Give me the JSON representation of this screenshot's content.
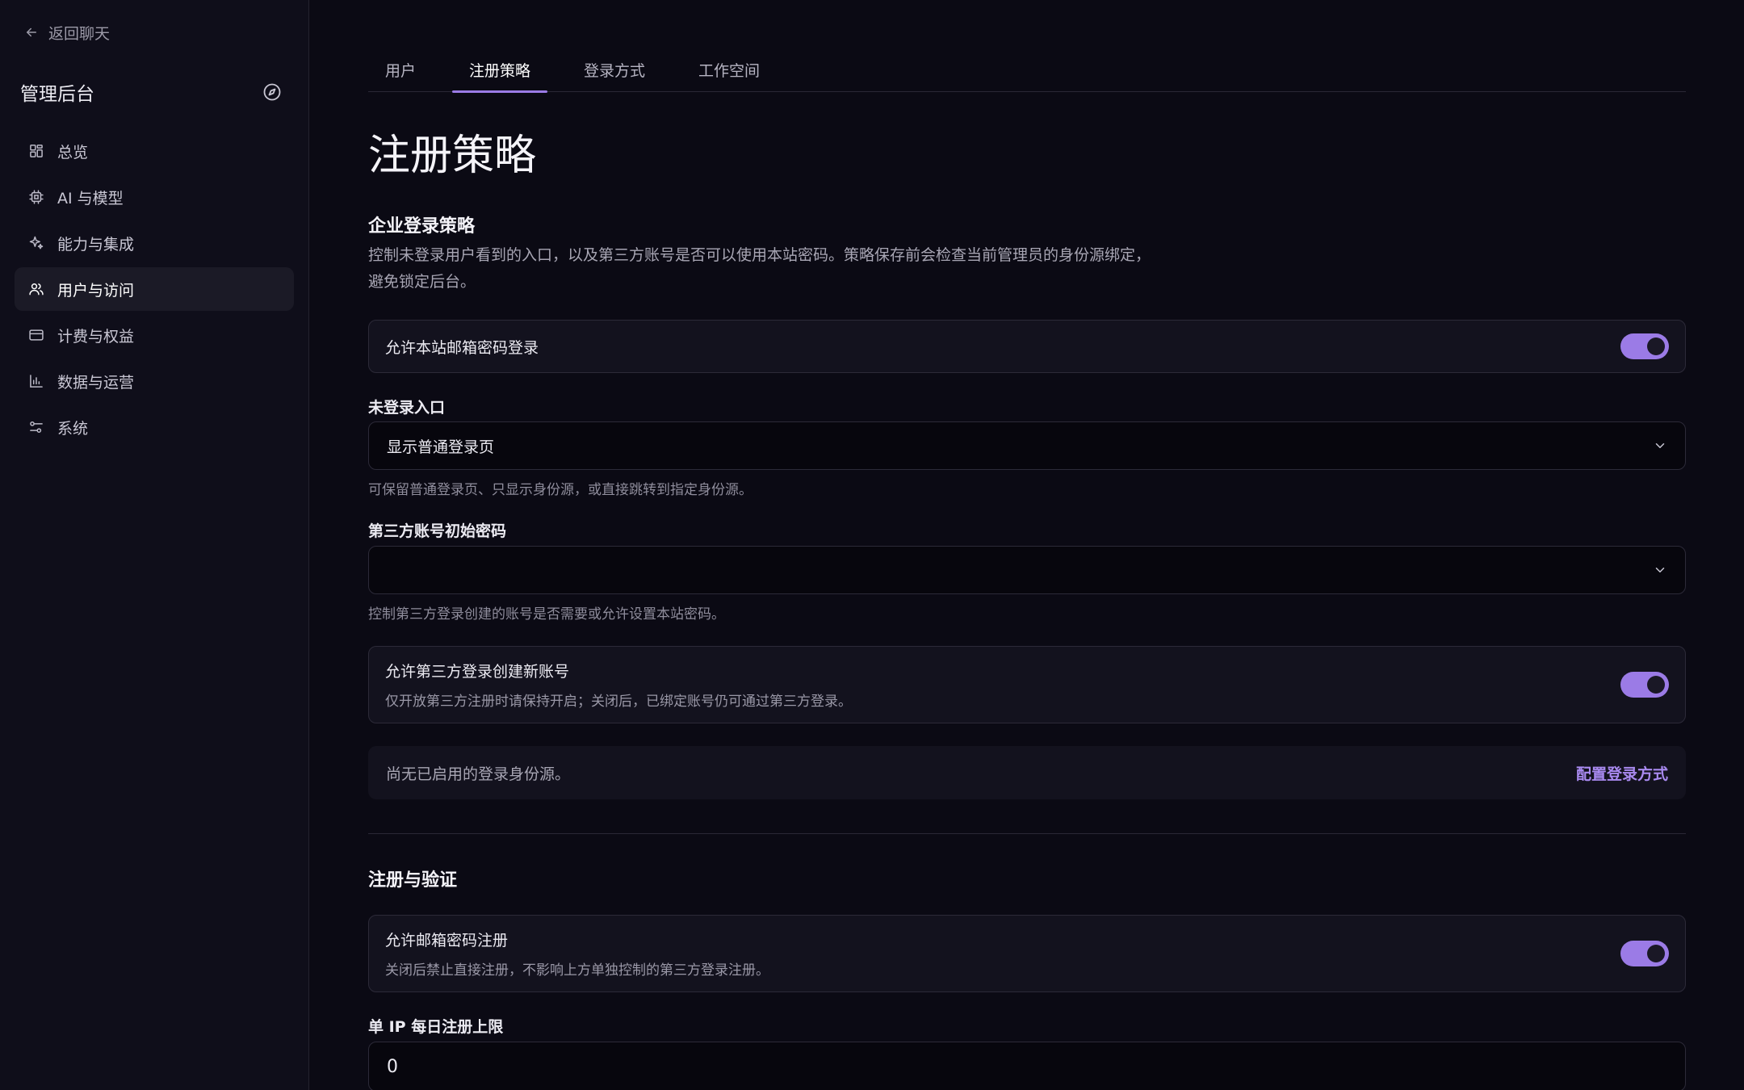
{
  "sidebar": {
    "back_label": "返回聊天",
    "title": "管理后台",
    "items": [
      {
        "label": "总览",
        "icon": "dashboard-icon"
      },
      {
        "label": "AI 与模型",
        "icon": "chip-icon"
      },
      {
        "label": "能力与集成",
        "icon": "sparkle-icon"
      },
      {
        "label": "用户与访问",
        "icon": "users-icon",
        "active": true
      },
      {
        "label": "计费与权益",
        "icon": "credit-card-icon"
      },
      {
        "label": "数据与运营",
        "icon": "bar-chart-icon"
      },
      {
        "label": "系统",
        "icon": "sliders-icon"
      }
    ]
  },
  "tabs": [
    {
      "label": "用户"
    },
    {
      "label": "注册策略",
      "active": true
    },
    {
      "label": "登录方式"
    },
    {
      "label": "工作空间"
    }
  ],
  "page": {
    "title": "注册策略",
    "enterprise": {
      "heading": "企业登录策略",
      "description_line1": "控制未登录用户看到的入口，以及第三方账号是否可以使用本站密码。策略保存前会检查当前管理员的身份源绑定，",
      "description_line2": "避免锁定后台。",
      "email_login_toggle": {
        "label": "允许本站邮箱密码登录",
        "enabled": true
      },
      "entry": {
        "label": "未登录入口",
        "value": "显示普通登录页",
        "help": "可保留普通登录页、只显示身份源，或直接跳转到指定身份源。"
      },
      "third_party_password": {
        "label": "第三方账号初始密码",
        "value": "",
        "help": "控制第三方登录创建的账号是否需要或允许设置本站密码。"
      },
      "third_party_create": {
        "label": "允许第三方登录创建新账号",
        "sub": "仅开放第三方注册时请保持开启；关闭后，已绑定账号仍可通过第三方登录。",
        "enabled": true
      },
      "notice": {
        "text": "尚无已启用的登录身份源。",
        "link": "配置登录方式"
      }
    },
    "registration": {
      "heading": "注册与验证",
      "email_register": {
        "label": "允许邮箱密码注册",
        "sub": "关闭后禁止直接注册，不影响上方单独控制的第三方登录注册。",
        "enabled": true
      },
      "ip_limit": {
        "label": "单 IP 每日注册上限",
        "value": "0"
      }
    }
  },
  "colors": {
    "accent": "#9b7be6",
    "link": "#a98af0",
    "background": "#0b0a14",
    "sidebar": "#0f0e1a"
  }
}
